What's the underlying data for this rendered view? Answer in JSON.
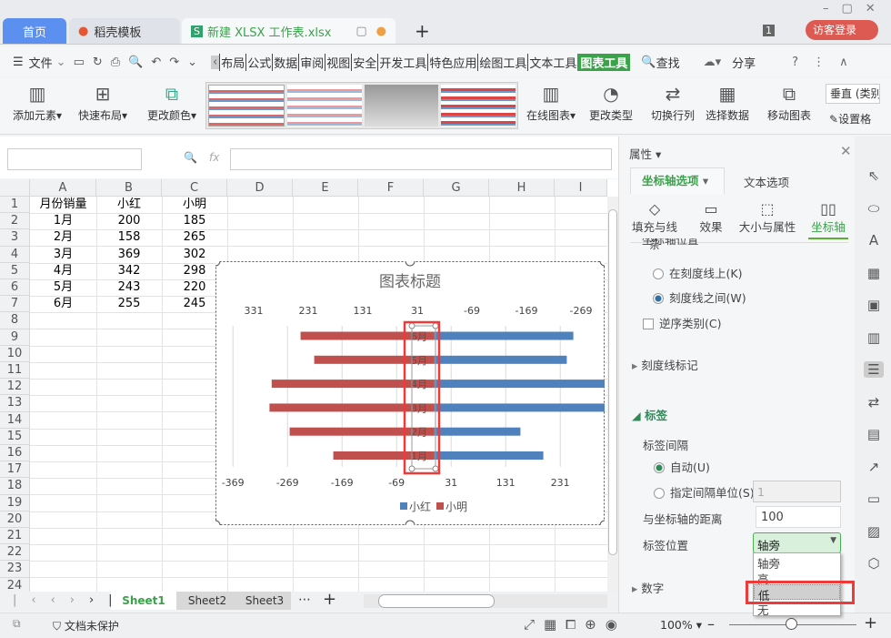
{
  "titlebar": {
    "tabs": [
      {
        "label": "首页"
      },
      {
        "label": "稻壳模板"
      },
      {
        "label": "新建 XLSX 工作表.xlsx"
      }
    ],
    "badge": "1",
    "login": "访客登录"
  },
  "menu": {
    "file": "文件",
    "tabs": [
      "布局",
      "公式",
      "数据",
      "审阅",
      "视图",
      "安全",
      "开发工具",
      "特色应用",
      "绘图工具",
      "文本工具",
      "图表工具"
    ],
    "active": "图表工具",
    "search": "查找",
    "share": "分享"
  },
  "ribbon": {
    "add_element": "添加元素",
    "quick_layout": "快速布局",
    "change_color": "更改颜色",
    "online_chart": "在线图表",
    "change_type": "更改类型",
    "switch_row_col": "切换行列",
    "select_data": "选择数据",
    "move_chart": "移动图表",
    "axis_select": "垂直 (类别",
    "format": "设置格"
  },
  "formula": {
    "fx": "fx",
    "name_box": "",
    "value": ""
  },
  "sheet": {
    "columns": [
      "A",
      "B",
      "C",
      "D",
      "E",
      "F",
      "G",
      "H",
      "I"
    ],
    "rows": [
      "1",
      "2",
      "3",
      "4",
      "5",
      "6",
      "7",
      "8",
      "9",
      "10",
      "11",
      "12",
      "13",
      "14",
      "15",
      "16",
      "17",
      "18",
      "19",
      "20",
      "21",
      "22",
      "23",
      "24"
    ],
    "cells": [
      [
        "月份销量",
        "小红",
        "小明"
      ],
      [
        "1月",
        "200",
        "185"
      ],
      [
        "2月",
        "158",
        "265"
      ],
      [
        "3月",
        "369",
        "302"
      ],
      [
        "4月",
        "342",
        "298"
      ],
      [
        "5月",
        "243",
        "220"
      ],
      [
        "6月",
        "255",
        "245"
      ]
    ]
  },
  "chart_data": {
    "type": "bar",
    "title": "图表标题",
    "categories": [
      "1月",
      "2月",
      "3月",
      "4月",
      "5月",
      "6月"
    ],
    "series": [
      {
        "name": "小红",
        "values": [
          200,
          158,
          369,
          342,
          243,
          255
        ],
        "color": "#4f81bd",
        "axis": "primary"
      },
      {
        "name": "小明",
        "values": [
          185,
          265,
          302,
          298,
          220,
          245
        ],
        "color": "#c0504d",
        "axis": "secondary-reversed"
      }
    ],
    "x_ticks_bottom": [
      "-369",
      "-269",
      "-169",
      "-69",
      "31",
      "131",
      "231"
    ],
    "x_ticks_top": [
      "331",
      "231",
      "131",
      "31",
      "-69",
      "-169",
      "-269"
    ],
    "xlim": [
      -369,
      231
    ],
    "grid": true,
    "legend": "bottom"
  },
  "panel": {
    "title": "属性",
    "tab1": "坐标轴选项",
    "tab2": "文本选项",
    "subtabs": [
      "填充与线条",
      "效果",
      "大小与属性",
      "坐标轴"
    ],
    "section_cut": "坐标轴位置",
    "on_tick": "在刻度线上(K)",
    "between_tick": "刻度线之间(W)",
    "reverse": "逆序类别(C)",
    "tick_marks": "刻度线标记",
    "labels": "标签",
    "label_interval": "标签间隔",
    "auto": "自动(U)",
    "specify": "指定间隔单位(S)",
    "specify_value": "1",
    "distance_label": "与坐标轴的距离",
    "distance_value": "100",
    "position_label": "标签位置",
    "position_value": "轴旁",
    "options": [
      "轴旁",
      "高",
      "低",
      "无"
    ],
    "number": "数字"
  },
  "sheets": [
    "Sheet1",
    "Sheet2",
    "Sheet3"
  ],
  "status": {
    "protect": "文档未保护",
    "zoom": "100%"
  },
  "colors": {
    "accent": "#4caf50",
    "highlight": "#ff3333"
  }
}
